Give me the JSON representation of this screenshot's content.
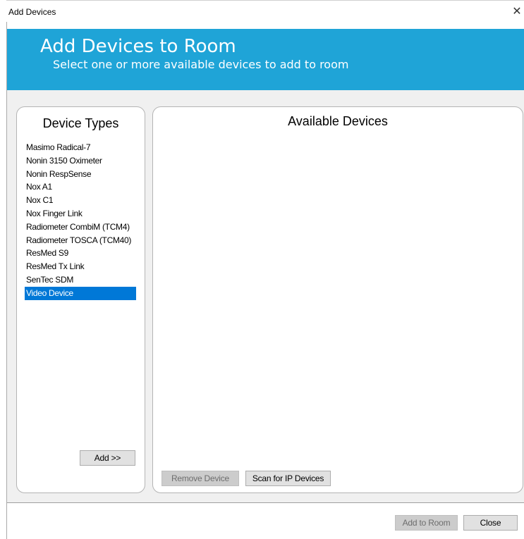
{
  "window": {
    "title": "Add Devices",
    "close_glyph": "✕"
  },
  "header": {
    "title": "Add Devices to Room",
    "subtitle": "Select one or more available devices to add to room",
    "background": "#1fa4d7"
  },
  "device_types": {
    "title": "Device Types",
    "items": [
      "Masimo Radical-7",
      "Nonin 3150 Oximeter",
      "Nonin RespSense",
      "Nox A1",
      "Nox C1",
      "Nox Finger Link",
      "Radiometer CombiM (TCM4)",
      "Radiometer TOSCA (TCM40)",
      "ResMed S9",
      "ResMed Tx Link",
      "SenTec SDM",
      "Video Device"
    ],
    "selected": "Video Device",
    "add_label": "Add >>"
  },
  "available_devices": {
    "title": "Available Devices",
    "remove_label": "Remove Device",
    "scan_label": "Scan for IP Devices"
  },
  "footer": {
    "add_to_room_label": "Add to Room",
    "close_label": "Close"
  },
  "colors": {
    "selection": "#0078d7",
    "header": "#1fa4d7"
  }
}
